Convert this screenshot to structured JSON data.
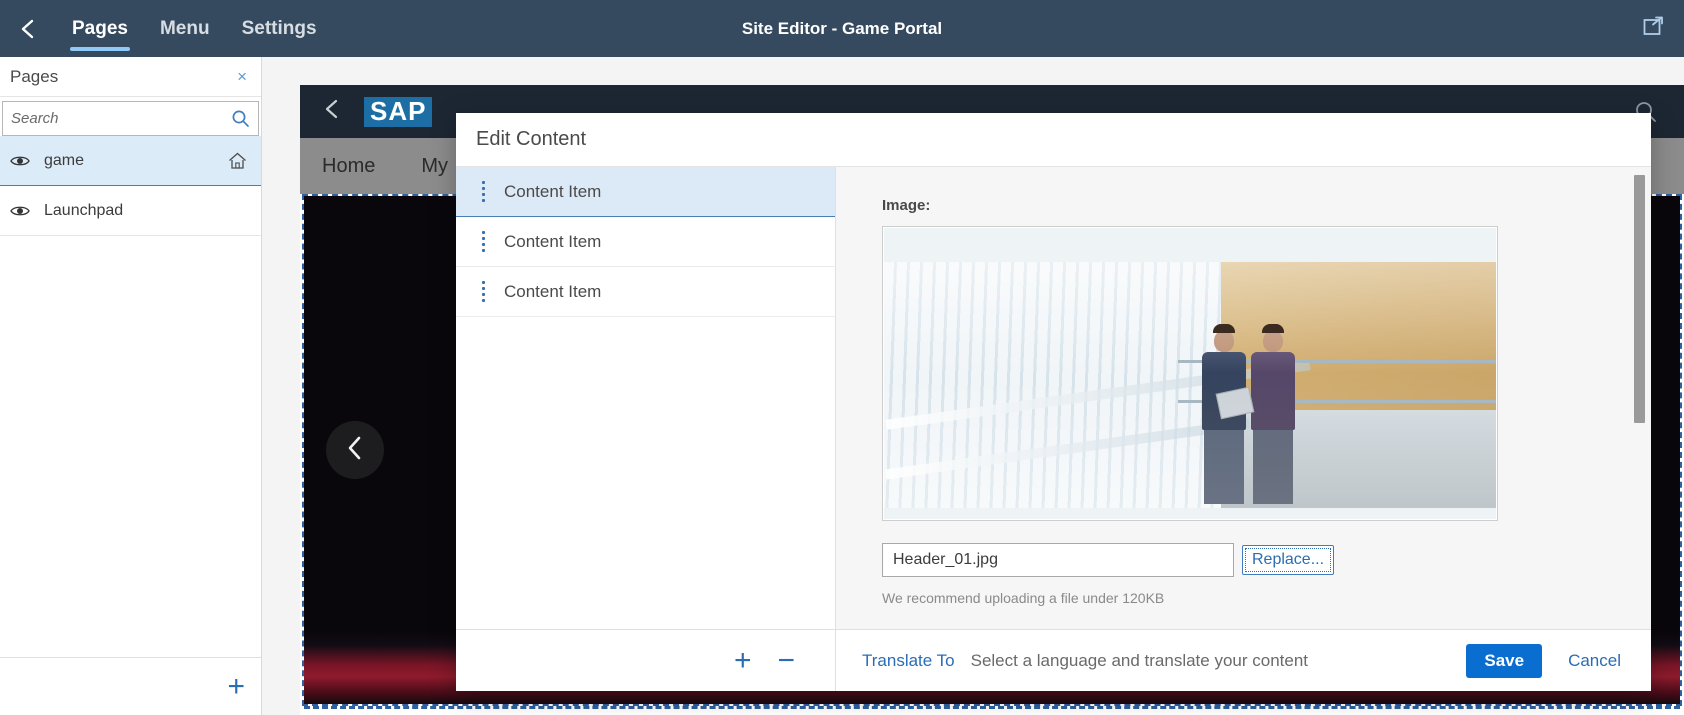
{
  "appbar": {
    "back_icon": "chevron-left-icon",
    "tabs": [
      {
        "label": "Pages",
        "active": true
      },
      {
        "label": "Menu",
        "active": false
      },
      {
        "label": "Settings",
        "active": false
      }
    ],
    "title": "Site Editor - Game Portal",
    "open_new_window_icon": "open-in-new-window-icon"
  },
  "sidebar": {
    "title": "Pages",
    "close_label": "×",
    "search": {
      "value": "",
      "placeholder": "Search",
      "icon": "search-icon"
    },
    "pages": [
      {
        "label": "game",
        "selected": true,
        "eye_icon": "eye-icon",
        "home_icon": "home-icon",
        "is_home": true
      },
      {
        "label": "Launchpad",
        "selected": false,
        "eye_icon": "eye-icon",
        "home_icon": "home-icon",
        "is_home": false
      }
    ],
    "add_label": "+"
  },
  "preview": {
    "back_icon": "chevron-left-icon",
    "logo": "SAP",
    "search_icon": "search-icon",
    "nav": [
      "Home",
      "My"
    ],
    "carousel_prev_icon": "chevron-left-icon"
  },
  "dialog": {
    "title": "Edit Content",
    "items": [
      {
        "label": "Content Item",
        "selected": true,
        "grip_icon": "drag-handle-icon"
      },
      {
        "label": "Content Item",
        "selected": false,
        "grip_icon": "drag-handle-icon"
      },
      {
        "label": "Content Item",
        "selected": false,
        "grip_icon": "drag-handle-icon"
      }
    ],
    "detail": {
      "image_label": "Image:",
      "file_value": "Header_01.jpg",
      "file_placeholder": "",
      "replace_label": "Replace...",
      "hint": "We recommend uploading a file under 120KB"
    },
    "footer": {
      "add_label": "+",
      "remove_label": "−",
      "translate_link": "Translate To",
      "translate_hint": "Select a language and translate your content",
      "save_label": "Save",
      "cancel_label": "Cancel"
    }
  },
  "colors": {
    "appbar_bg": "#354a5f",
    "accent_blue": "#2a6db5",
    "save_blue": "#0a6ed1",
    "selected_row": "#dceaf7"
  }
}
